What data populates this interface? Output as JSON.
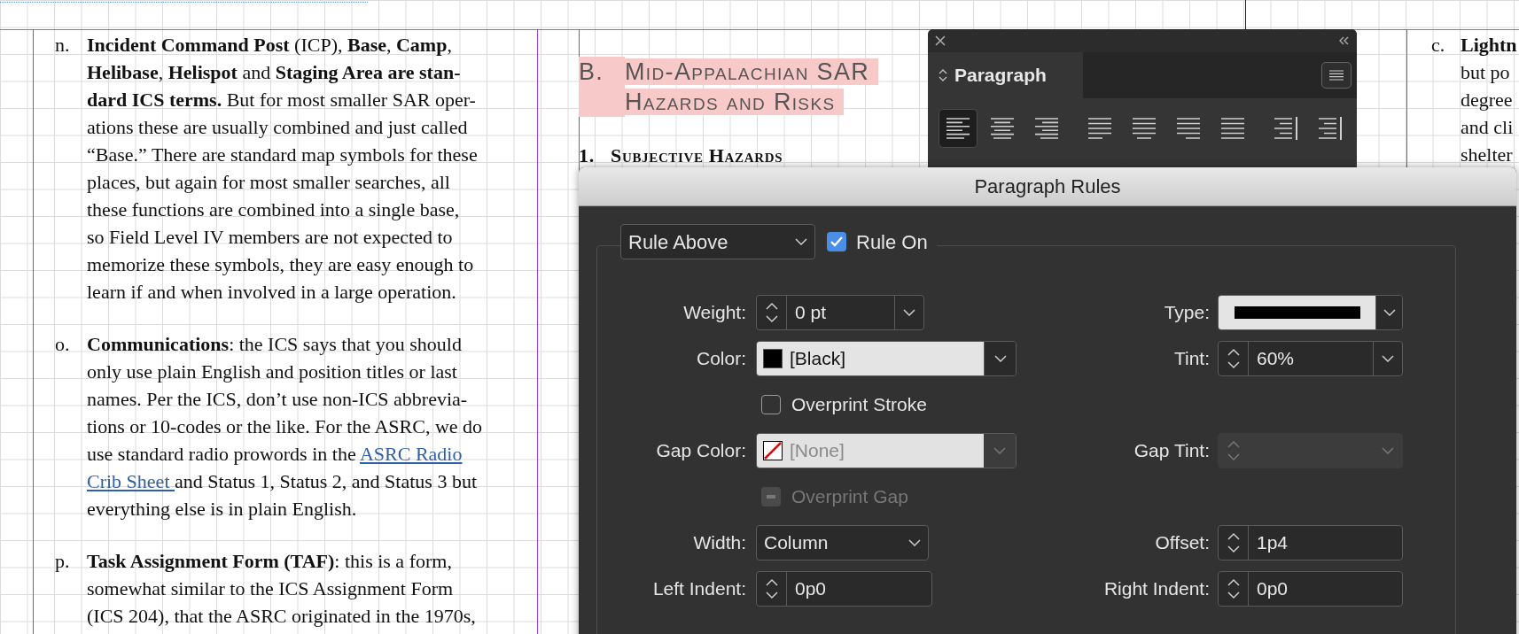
{
  "document": {
    "left_column": [
      {
        "marker": "n.",
        "lines": [
          [
            {
              "text": "**Incident Command Post** (ICP), **Base**, **Camp**,"
            }
          ],
          [
            {
              "text": "**Helibase**, **Helispot** and **Staging Area are stan-**"
            }
          ],
          [
            {
              "text": "**dard ICS terms.** But for most smaller SAR oper-"
            }
          ],
          [
            {
              "text": "ations these are usually combined and just called"
            }
          ],
          [
            {
              "text": "“Base.” There are standard map symbols for these"
            }
          ],
          [
            {
              "text": "places, but again for most smaller searches, all"
            }
          ],
          [
            {
              "text": "these functions are combined into a single base,"
            }
          ],
          [
            {
              "text": "so Field Level IV members are not expected to"
            }
          ],
          [
            {
              "text": "memorize these symbols, they are easy enough to"
            }
          ],
          [
            {
              "text": "learn if and when involved in a large operation."
            }
          ]
        ]
      },
      {
        "marker": "o.",
        "lines": [
          [
            {
              "text": "**Communications**: the ICS says that you should"
            }
          ],
          [
            {
              "text": "only use plain English and position titles or last"
            }
          ],
          [
            {
              "text": "names. Per the ICS, don’t use non-ICS abbrevia-"
            }
          ],
          [
            {
              "text": "tions or 10-codes or the like. For the ASRC, we do"
            }
          ],
          [
            {
              "text": "use standard radio prowords in the "
            },
            {
              "text": "ASRC Radio",
              "kind": "link"
            }
          ],
          [
            {
              "text": "Crib Sheet ",
              "kind": "link"
            },
            {
              "text": "and Status 1, Status 2, and Status 3 but"
            }
          ],
          [
            {
              "text": "everything else is in plain English."
            }
          ]
        ]
      },
      {
        "marker": "p.",
        "lines": [
          [
            {
              "text": "**Task Assignment Form (TAF)**: this is a form,"
            }
          ],
          [
            {
              "text": "somewhat similar to the ICS Assignment Form"
            }
          ],
          [
            {
              "text": "(ICS 204), that the ASRC originated in the 1970s,"
            }
          ]
        ]
      }
    ],
    "middle_column": {
      "heading": {
        "marker": "B.",
        "lines": [
          "Mid-Appalachian SAR",
          "Hazards and Risks"
        ],
        "highlighted": true
      },
      "subheading": {
        "marker": "1.",
        "text": "Subjective Hazards"
      }
    },
    "right_column": {
      "marker": "c.",
      "lines": [
        "**Lightn**",
        "but po",
        "degree",
        "and cli",
        "shelter"
      ]
    }
  },
  "paragraph_panel": {
    "title": "Paragraph",
    "alignments": [
      {
        "kind": "left",
        "selected": true
      },
      {
        "kind": "center",
        "selected": false
      },
      {
        "kind": "right",
        "selected": false
      },
      {
        "kind": "justify-left",
        "selected": false
      },
      {
        "kind": "justify-center",
        "selected": false
      },
      {
        "kind": "justify-right",
        "selected": false
      },
      {
        "kind": "justify-all",
        "selected": false
      },
      {
        "kind": "towards-spine",
        "selected": false
      },
      {
        "kind": "away-from-spine",
        "selected": false
      }
    ]
  },
  "dialog": {
    "title": "Paragraph Rules",
    "rule_select": "Rule Above",
    "rule_on": {
      "label": "Rule On",
      "checked": true
    },
    "rows": [
      {
        "left": {
          "kind": "spin-combo",
          "label": "Weight:",
          "value": "0 pt",
          "disabled": false
        },
        "right": {
          "kind": "stroke-type",
          "label": "Type:",
          "disabled": false
        }
      },
      {
        "left": {
          "kind": "swatch",
          "label": "Color:",
          "value": "[Black]",
          "swatch": {
            "kind": "black"
          },
          "disabled": false
        },
        "right": {
          "kind": "spin-combo",
          "label": "Tint:",
          "value": "60%",
          "disabled": false
        }
      },
      {
        "left": {
          "kind": "checkbox",
          "label": "Overprint Stroke",
          "checked": false,
          "mixed": false,
          "disabled": false
        }
      },
      {
        "left": {
          "kind": "swatch",
          "label": "Gap Color:",
          "value": "[None]",
          "swatch": {
            "kind": "none"
          },
          "disabled": true
        },
        "right": {
          "kind": "spin-combo",
          "label": "Gap Tint:",
          "disabled": true
        }
      },
      {
        "left": {
          "kind": "checkbox",
          "label": "Overprint Gap",
          "checked": false,
          "mixed": true,
          "disabled": true
        }
      },
      {
        "left": {
          "kind": "dropdown",
          "label": "Width:",
          "value": "Column",
          "disabled": false
        },
        "right": {
          "kind": "spinner",
          "label": "Offset:",
          "value": "1p4",
          "disabled": false
        }
      },
      {
        "left": {
          "kind": "spinner",
          "label": "Left Indent:",
          "value": "0p0",
          "disabled": false
        },
        "right": {
          "kind": "spinner",
          "label": "Right Indent:",
          "value": "0p0",
          "disabled": false
        }
      }
    ]
  }
}
